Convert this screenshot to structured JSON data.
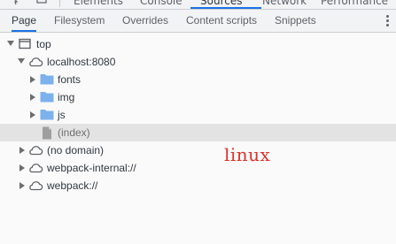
{
  "top_tabs": [
    {
      "label": "Elements"
    },
    {
      "label": "Console"
    },
    {
      "label": "Sources",
      "active": true
    },
    {
      "label": "Network"
    },
    {
      "label": "Performance"
    }
  ],
  "sub_tabs": [
    {
      "label": "Page",
      "active": true
    },
    {
      "label": "Filesystem"
    },
    {
      "label": "Overrides"
    },
    {
      "label": "Content scripts"
    },
    {
      "label": "Snippets"
    }
  ],
  "tree": [
    {
      "label": "top",
      "depth": 0,
      "expanded": true,
      "icon": "frame-icon"
    },
    {
      "label": "localhost:8080",
      "depth": 1,
      "expanded": true,
      "icon": "cloud-icon"
    },
    {
      "label": "fonts",
      "depth": 2,
      "expanded": false,
      "icon": "folder-icon"
    },
    {
      "label": "img",
      "depth": 2,
      "expanded": false,
      "icon": "folder-icon"
    },
    {
      "label": "js",
      "depth": 2,
      "expanded": false,
      "icon": "folder-icon"
    },
    {
      "label": "(index)",
      "depth": 2,
      "icon": "file-icon",
      "selected": true
    },
    {
      "label": "(no domain)",
      "depth": 1,
      "expanded": false,
      "icon": "cloud-icon"
    },
    {
      "label": "webpack-internal://",
      "depth": 1,
      "expanded": false,
      "icon": "cloud-icon"
    },
    {
      "label": "webpack://",
      "depth": 1,
      "expanded": false,
      "icon": "cloud-icon"
    }
  ],
  "watermark": "linux",
  "colors": {
    "accent": "#1a73e8",
    "folder": "#7cb1ec",
    "watermark": "#e0302a",
    "selected_row": "#e3e3e3"
  }
}
